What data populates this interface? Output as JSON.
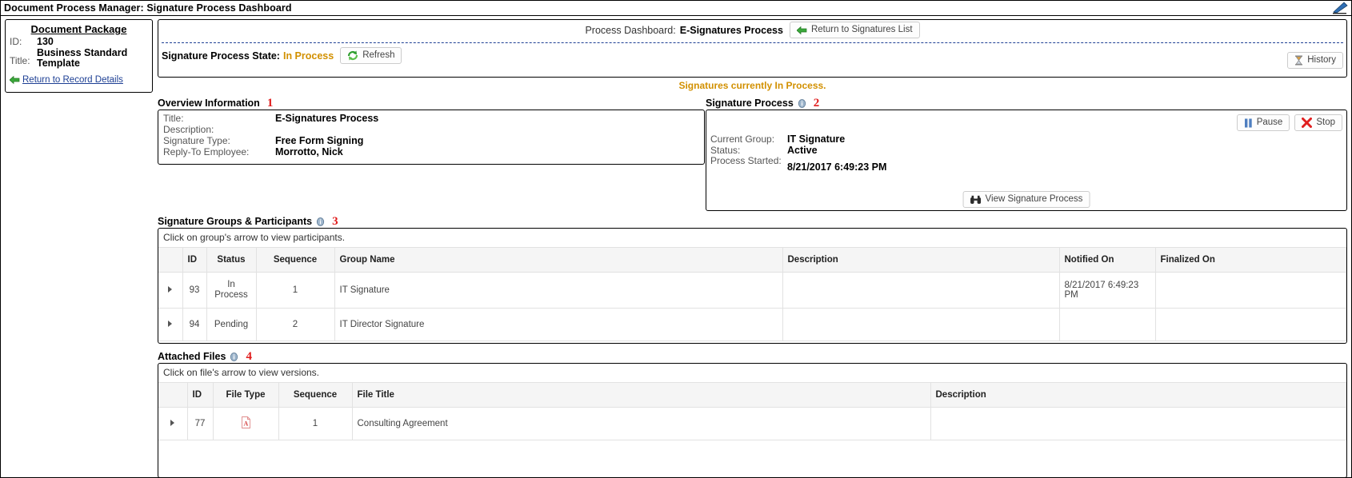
{
  "window": {
    "title": "Document Process Manager: Signature Process Dashboard",
    "corner_icon": "hand-pointer-icon"
  },
  "package": {
    "heading": "Document Package",
    "id_label": "ID:",
    "id_value": "130",
    "title_label": "Title:",
    "title_value": "Business Standard Template",
    "return_link": "Return to Record Details",
    "return_link_icon": "green-left-arrow-icon"
  },
  "dashboard": {
    "label": "Process Dashboard:",
    "value": "E-Signatures Process",
    "return_button": "Return to Signatures List",
    "return_button_icon": "green-left-arrow-icon",
    "state_label": "Signature Process State:",
    "state_value": "In Process",
    "refresh_button": "Refresh",
    "refresh_icon": "refresh-icon",
    "history_button": "History",
    "history_icon": "hourglass-icon",
    "notice": "Signatures currently In Process."
  },
  "overview": {
    "heading": "Overview Information",
    "badge": "1",
    "rows": [
      {
        "label": "Title:",
        "value": "E-Signatures Process"
      },
      {
        "label": "Description:",
        "value": ""
      },
      {
        "label": "Signature Type:",
        "value": "Free Form Signing"
      },
      {
        "label": "Reply-To Employee:",
        "value": "Morrotto, Nick"
      }
    ]
  },
  "signature_process": {
    "heading": "Signature Process",
    "badge": "2",
    "info_icon": "info-icon",
    "pause_button": "Pause",
    "pause_icon": "pause-icon",
    "stop_button": "Stop",
    "stop_icon": "stop-x-icon",
    "rows": [
      {
        "label": "Current Group:",
        "value": "IT Signature"
      },
      {
        "label": "Status:",
        "value": "Active"
      },
      {
        "label": "Process Started:",
        "value": "8/21/2017 6:49:23 PM"
      }
    ],
    "view_button": "View Signature Process",
    "view_icon": "binoculars-icon"
  },
  "groups": {
    "heading": "Signature Groups & Participants",
    "badge": "3",
    "info_icon": "info-icon",
    "hint": "Click on group's arrow to view participants.",
    "columns": [
      "",
      "ID",
      "Status",
      "Sequence",
      "Group Name",
      "Description",
      "Notified On",
      "Finalized On"
    ],
    "rows": [
      {
        "expand_icon": "triangle-right-icon",
        "id": "93",
        "status": "In Process",
        "status_color": "#d29000",
        "sequence": "1",
        "group_name": "IT Signature",
        "description": "",
        "notified_on": "8/21/2017 6:49:23 PM",
        "finalized_on": ""
      },
      {
        "expand_icon": "triangle-right-icon",
        "id": "94",
        "status": "Pending",
        "status_color": "#2a6099",
        "sequence": "2",
        "group_name": "IT Director Signature",
        "description": "",
        "notified_on": "",
        "finalized_on": ""
      }
    ]
  },
  "attached_files": {
    "heading": "Attached Files",
    "badge": "4",
    "info_icon": "info-icon",
    "hint": "Click on file's arrow to view versions.",
    "columns": [
      "",
      "ID",
      "File Type",
      "Sequence",
      "File Title",
      "Description"
    ],
    "rows": [
      {
        "expand_icon": "triangle-right-icon",
        "id": "77",
        "file_type_icon": "pdf-icon",
        "sequence": "1",
        "file_title": "Consulting Agreement",
        "description": ""
      }
    ]
  },
  "colors": {
    "accent_orange": "#d29000",
    "accent_blue": "#2a6099",
    "badge_red": "#e01b1b",
    "link_blue": "#1d3f94"
  }
}
